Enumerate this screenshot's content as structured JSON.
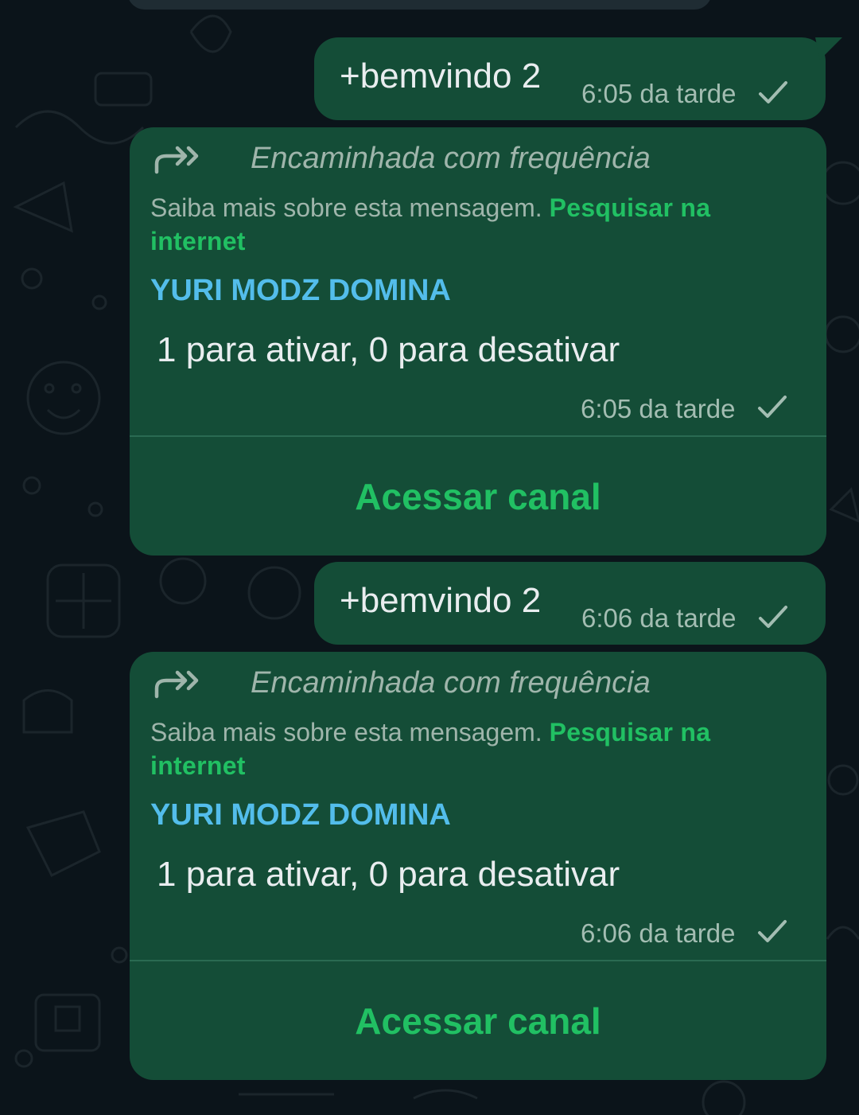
{
  "messages": [
    {
      "type": "outgoing_text",
      "text": "+bemvindo 2",
      "time": "6:05 da tarde",
      "status_icon": "check-icon"
    },
    {
      "type": "forwarded_channel_message",
      "forwarded_label": "Encaminhada com frequência",
      "learn_more_text": "Saiba mais sobre esta mensagem.",
      "learn_more_link": "Pesquisar na internet",
      "sender": "YURI MODZ DOMINA",
      "text": "1 para ativar, 0 para desativar",
      "time": "6:05 da tarde",
      "status_icon": "check-icon",
      "action_label": "Acessar canal"
    },
    {
      "type": "outgoing_text",
      "text": "+bemvindo 2",
      "time": "6:06 da tarde",
      "status_icon": "check-icon"
    },
    {
      "type": "forwarded_channel_message",
      "forwarded_label": "Encaminhada com frequência",
      "learn_more_text": "Saiba mais sobre esta mensagem.",
      "learn_more_link": "Pesquisar na internet",
      "sender": "YURI MODZ DOMINA",
      "text": "1 para ativar, 0 para desativar",
      "time": "6:06 da tarde",
      "status_icon": "check-icon",
      "action_label": "Acessar canal"
    }
  ],
  "colors": {
    "background": "#0b141a",
    "bubble": "#144d37",
    "link_green": "#21c063",
    "sender_blue": "#53bdeb",
    "meta_text": "#9fb5ab"
  }
}
